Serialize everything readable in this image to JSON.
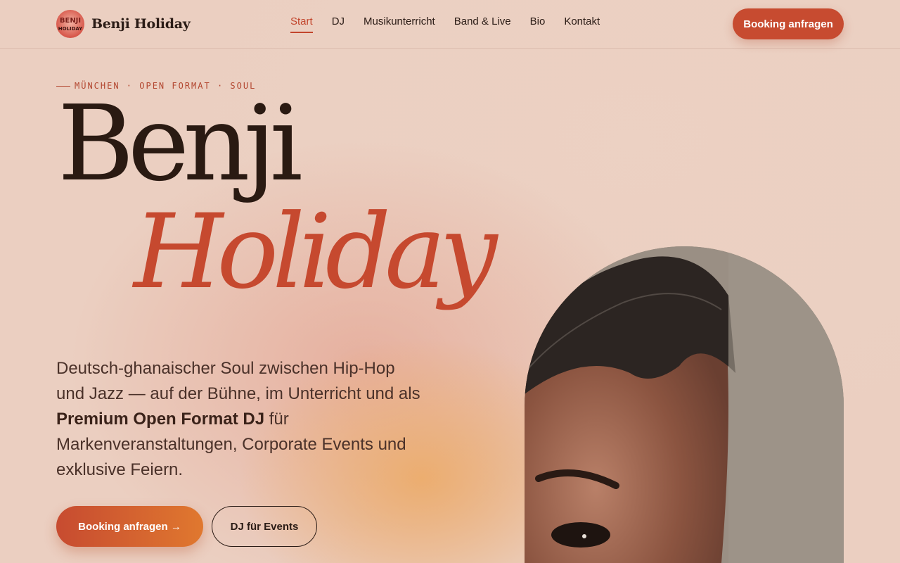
{
  "brand": {
    "name": "Benji Holiday",
    "logo_text_top": "BENJI",
    "logo_text_bottom": "HOLIDAY"
  },
  "nav": {
    "items": [
      {
        "label": "Start",
        "active": true
      },
      {
        "label": "DJ"
      },
      {
        "label": "Musikunterricht"
      },
      {
        "label": "Band & Live"
      },
      {
        "label": "Bio"
      },
      {
        "label": "Kontakt"
      }
    ],
    "cta_label": "Booking anfragen"
  },
  "hero": {
    "eyebrow": "MÜNCHEN · OPEN FORMAT · SOUL",
    "title_line1": "Benji",
    "title_line2": "Holiday",
    "lead_before": "Deutsch-ghanaischer Soul zwischen Hip-Hop und Jazz — auf der Bühne, im Unterricht und als ",
    "lead_strong": "Premium Open Format DJ",
    "lead_after": " für Markenveranstaltungen, Corporate Events und exklusive Feiern.",
    "primary_cta": "Booking anfragen",
    "primary_cta_arrow": "→",
    "secondary_cta": "DJ für Events"
  },
  "colors": {
    "accent": "#c74b30",
    "background": "#ebcfc1",
    "text": "#2b1c16"
  }
}
